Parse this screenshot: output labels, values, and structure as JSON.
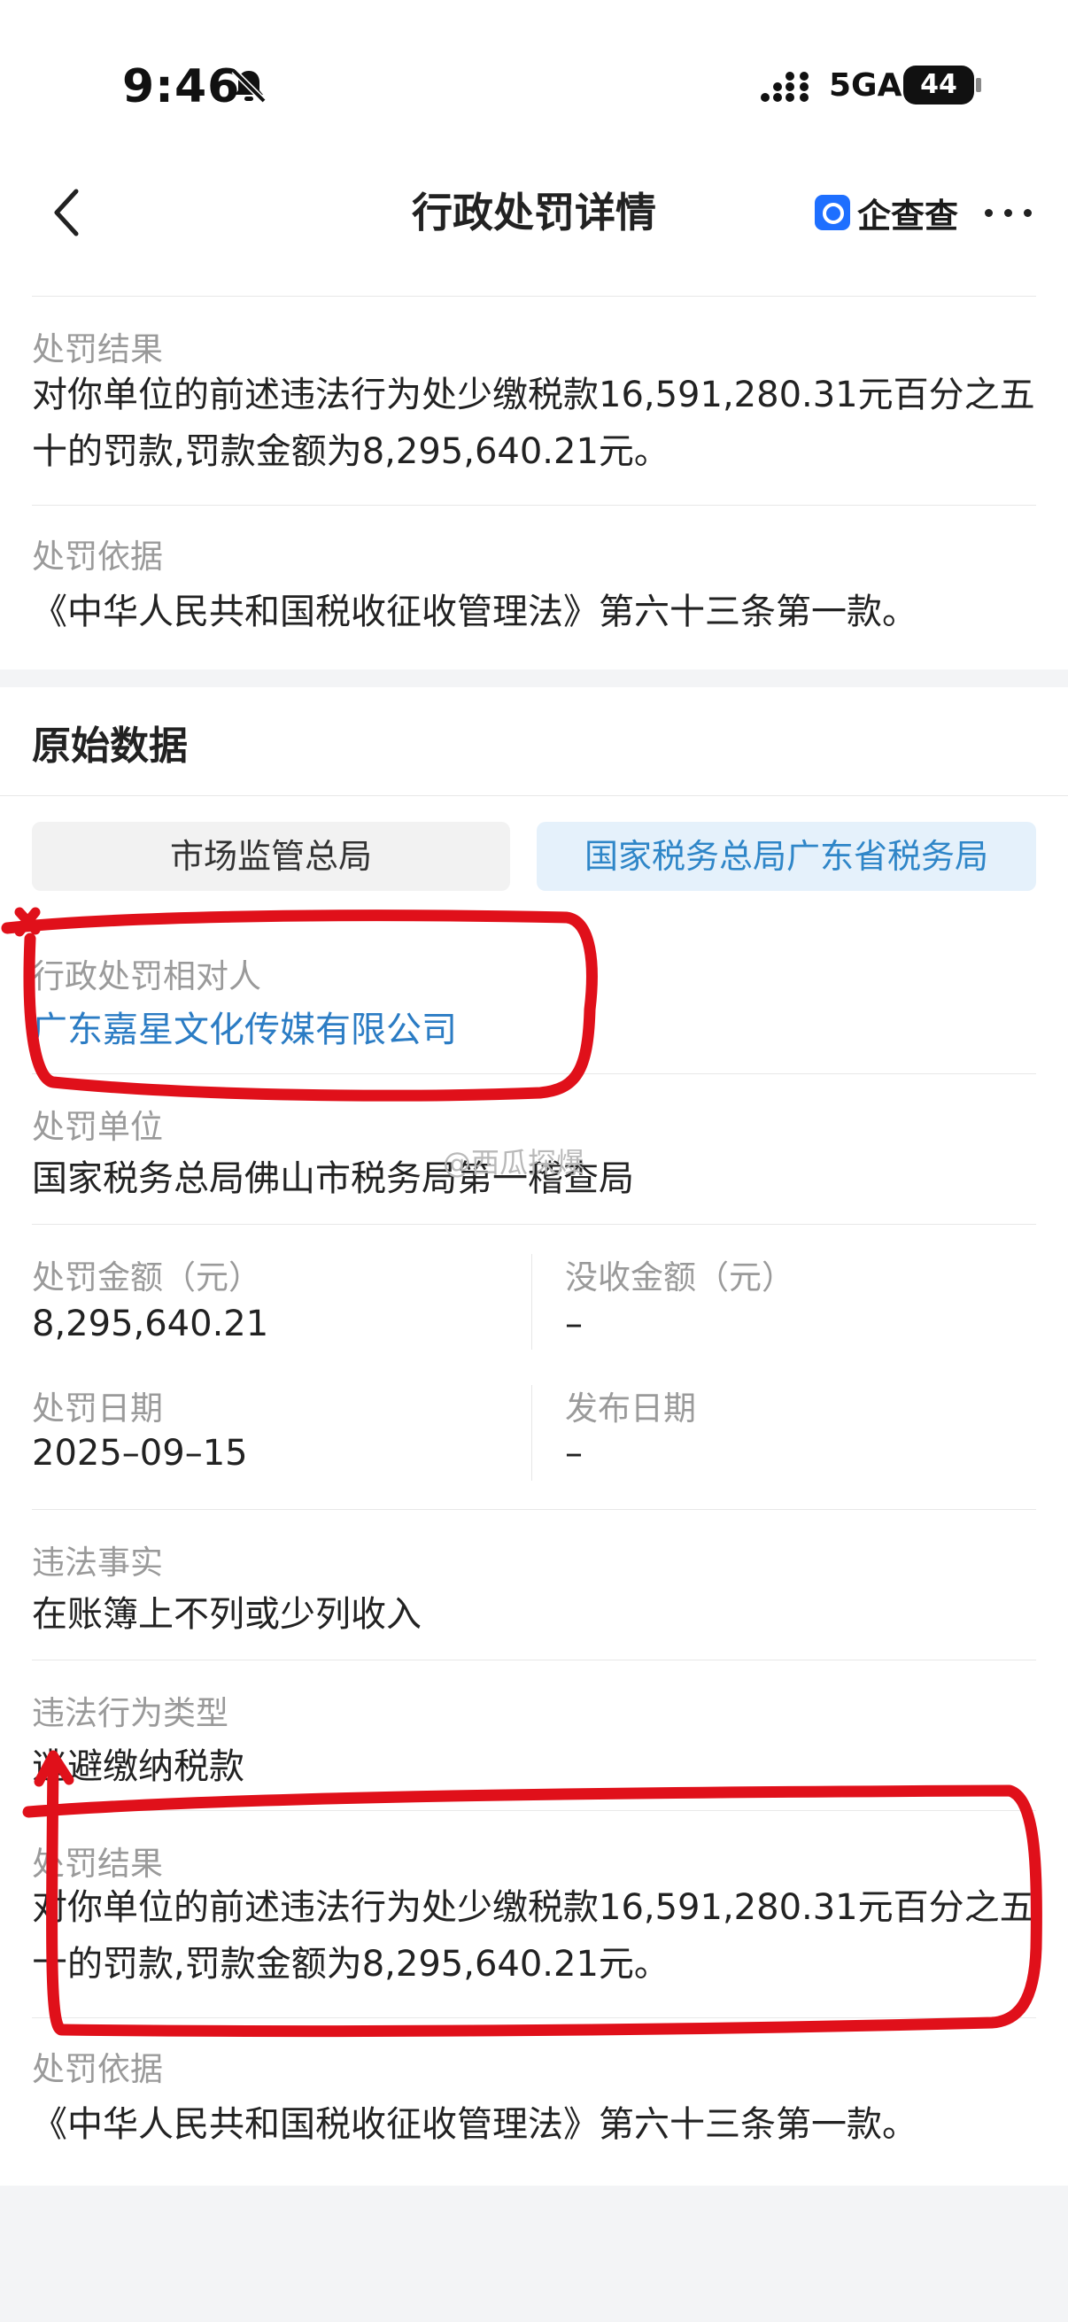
{
  "status_bar": {
    "time": "9:46",
    "network": "5GA",
    "battery": "44"
  },
  "header": {
    "title": "行政处罚详情",
    "brand": "企查查"
  },
  "summary": {
    "result_label": "处罚结果",
    "result_value": "对你单位的前述违法行为处少缴税款16,591,280.31元百分之五十的罚款,罚款金额为8,295,640.21元。",
    "basis_label": "处罚依据",
    "basis_value": "《中华人民共和国税收征收管理法》第六十三条第一款。"
  },
  "original": {
    "section_title": "原始数据",
    "tabs": [
      "市场监管总局",
      "国家税务总局广东省税务局"
    ],
    "party_label": "行政处罚相对人",
    "party_value": "广东嘉星文化传媒有限公司",
    "authority_label": "处罚单位",
    "authority_value": "国家税务总局佛山市税务局第一稽查局",
    "watermark": "@西瓜探爆",
    "fine_label": "处罚金额（元）",
    "fine_value": "8,295,640.21",
    "confiscated_label": "没收金额（元）",
    "confiscated_value": "–",
    "date_label": "处罚日期",
    "date_value": "2025–09–15",
    "publish_label": "发布日期",
    "publish_value": "–",
    "facts_label": "违法事实",
    "facts_value": "在账簿上不列或少列收入",
    "type_label": "违法行为类型",
    "type_value": "逃避缴纳税款",
    "result_label": "处罚结果",
    "result_value": "对你单位的前述违法行为处少缴税款16,591,280.31元百分之五十的罚款,罚款金额为8,295,640.21元。",
    "basis_label": "处罚依据",
    "basis_value": "《中华人民共和国税收征收管理法》第六十三条第一款。"
  },
  "colors": {
    "accent": "#2b7cc4",
    "annotation": "#e0101a"
  }
}
